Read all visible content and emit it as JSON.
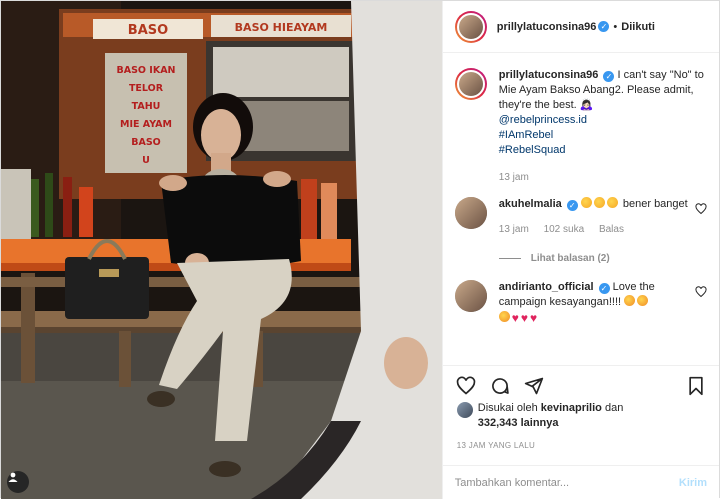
{
  "post": {
    "author": {
      "username": "prillylatuconsina96",
      "verified": true,
      "follow_state": "Diikuti",
      "separator": "•"
    },
    "photo": {
      "sign_top_left": "BASO",
      "sign_top_right": "BASO HIEAYAM",
      "sign_menu": [
        "BASO IKAN",
        "TELOR",
        "TAHU",
        "MIE AYAM",
        "BASO",
        "U"
      ]
    },
    "caption": {
      "username": "prillylatuconsina96",
      "text": "I can't say \"No\" to Mie Ayam Bakso Abang2. Please admit, they're the best. 🙇🏻‍♀️",
      "mention": "@rebelprincess.id",
      "hashtags": [
        "#IAmRebel",
        "#RebelSquad"
      ],
      "time": "13 jam"
    },
    "comments": [
      {
        "username": "akuhelmalia",
        "verified": true,
        "emoji_count": 3,
        "text": "bener banget",
        "time": "13 jam",
        "likes": "102 suka",
        "reply_label": "Balas",
        "view_replies": "Lihat balasan (2)"
      },
      {
        "username": "andirianto_official",
        "verified": true,
        "text": "Love the campaign kesayangan!!!!",
        "trailing_emoji": [
          "wink",
          "wink"
        ],
        "second_line_emoji": [
          "wink",
          "heart",
          "heart",
          "heart"
        ]
      }
    ],
    "likes_summary": {
      "prefix": "Disukai oleh",
      "liker": "kevinaprilio",
      "joiner": "dan",
      "count": "332,343 lainnya"
    },
    "timestamp": "13 JAM YANG LALU",
    "comment_input": {
      "placeholder": "Tambahkan komentar...",
      "post_label": "Kirim"
    }
  },
  "icons": [
    "heart-icon",
    "comment-icon",
    "share-icon",
    "bookmark-icon",
    "user-tag-icon",
    "verified-icon"
  ],
  "colors": {
    "verified_blue": "#3897f0",
    "link_blue": "#00376b",
    "muted_gray": "#8e8e8e",
    "post_button_disabled": "#b2dffc",
    "heart_red": "#e0245e"
  }
}
